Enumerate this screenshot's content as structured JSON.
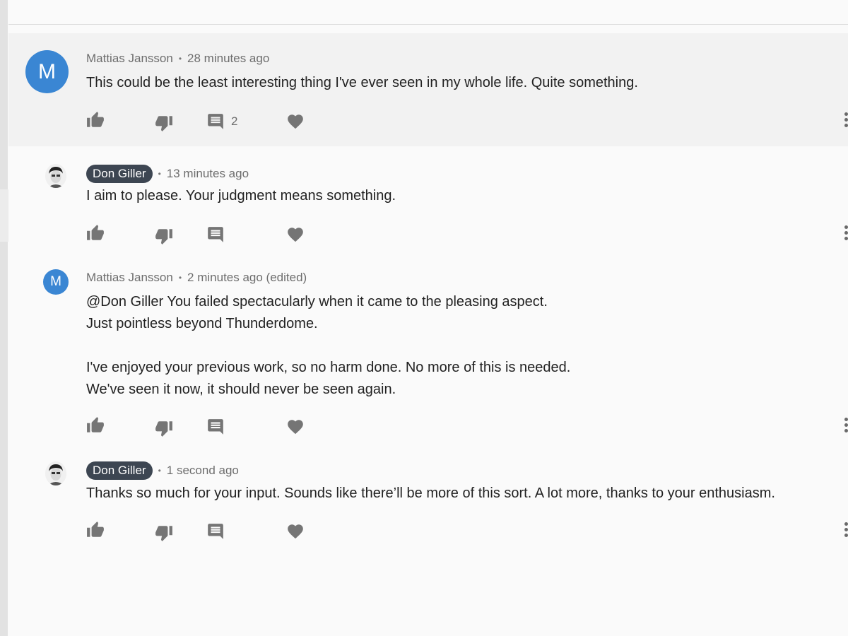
{
  "comments": [
    {
      "author": "Mattias Jansson",
      "avatar_letter": "M",
      "time": "28 minutes ago",
      "lines": [
        "This could be the least interesting thing I've ever seen in my whole life. Quite something."
      ],
      "reply_count": "2",
      "highlighted": true
    },
    {
      "author": "Don Giller",
      "author_badge": true,
      "time": "13 minutes ago",
      "lines": [
        "I aim to please. Your judgment means something."
      ],
      "reply_count": ""
    },
    {
      "author": "Mattias Jansson",
      "avatar_letter": "M",
      "time": "2 minutes ago (edited)",
      "lines": [
        "@Don Giller You failed spectacularly when it came to the pleasing aspect.",
        "Just pointless beyond Thunderdome.",
        "",
        "I've enjoyed your previous work, so no harm done. No more of this is needed.",
        "We've seen it now, it should never be seen again."
      ],
      "reply_count": ""
    },
    {
      "author": "Don Giller",
      "author_badge": true,
      "time": "1 second ago",
      "lines": [
        "Thanks so much for your input. Sounds like there’ll be more of this sort. A lot more, thanks to your enthusiasm."
      ],
      "reply_count": ""
    }
  ],
  "icons": {
    "like": "thumb-up-icon",
    "dislike": "thumb-down-icon",
    "reply": "comment-icon",
    "love": "heart-icon",
    "more": "more-vertical-icon"
  },
  "colors": {
    "avatar": "#3a86d3",
    "author_badge": "#3d4652",
    "highlight_bg": "#f2f2f2",
    "icon": "#757575"
  }
}
